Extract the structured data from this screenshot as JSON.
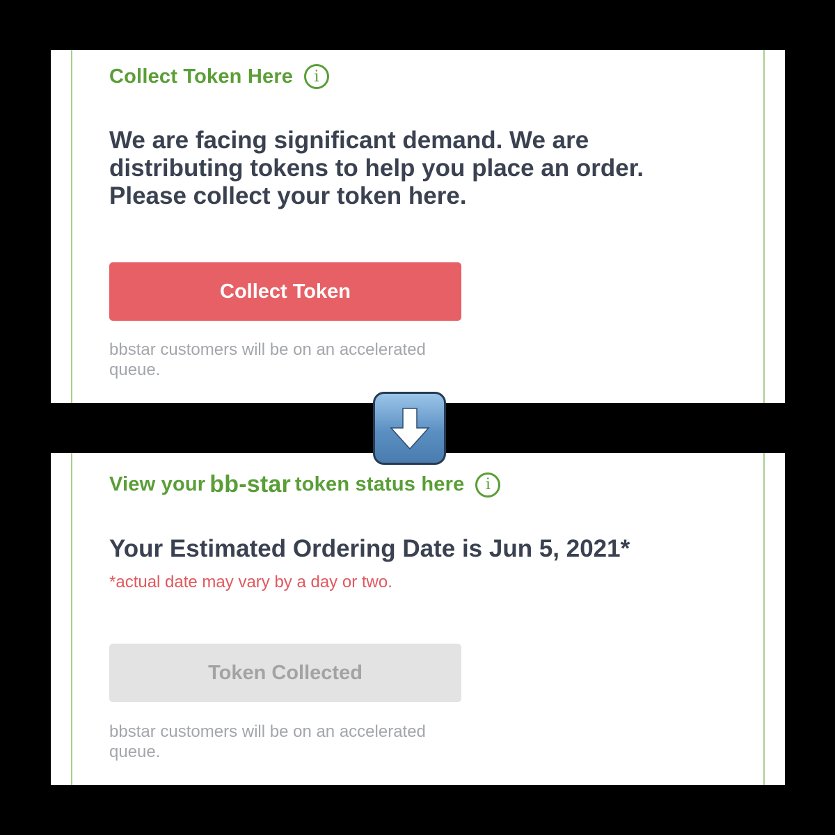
{
  "collect_card": {
    "heading": "Collect Token Here",
    "info_icon": "info-circle-icon",
    "message": "We are facing significant demand. We are distributing tokens to help you place an order. Please collect your token here.",
    "button_label": "Collect Token",
    "note": "bbstar customers will be on an accelerated queue."
  },
  "transition": {
    "icon": "down-arrow-emoji-icon"
  },
  "status_card": {
    "heading_prefix": "View your",
    "heading_brand": "bb-star",
    "heading_suffix": "token status here",
    "info_icon": "info-circle-icon",
    "estimated_date": "Your Estimated Ordering Date is Jun 5, 2021*",
    "disclaimer": "*actual date may vary by a day or two.",
    "button_label": "Token Collected",
    "note": "bbstar customers will be on an accelerated queue."
  },
  "colors": {
    "brand_green": "#5a9e37",
    "cta_red": "#e76066",
    "disabled_gray": "#e3e3e3",
    "text_dark": "#3a4150",
    "note_gray": "#a3a6ab",
    "warning_red": "#e0585e"
  }
}
